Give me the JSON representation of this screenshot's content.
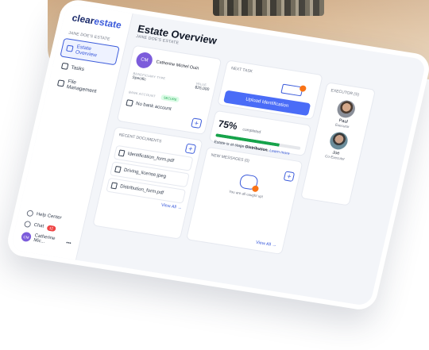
{
  "app": {
    "logo_text": "clear",
    "logo_accent": "estate",
    "brand_color": "#3b5bdb"
  },
  "sidebar": {
    "estate_label": "JANE DOE'S ESTATE",
    "items": [
      {
        "label": "Estate Overview",
        "icon": "home-icon",
        "active": true
      },
      {
        "label": "Tasks",
        "icon": "list-icon",
        "active": false
      },
      {
        "label": "File Management",
        "icon": "file-icon",
        "active": false
      }
    ],
    "help_label": "Help Center",
    "chat_label": "Chat",
    "chat_badge": "12",
    "user_initials": "CM",
    "user_name": "Catherine Mic...",
    "more": "•••"
  },
  "header": {
    "title": "Estate Overview",
    "subtitle": "JANE DOE'S ESTATE"
  },
  "beneficiary": {
    "initials": "CM",
    "name": "Catherine Michel Ouin",
    "type_label": "BENEFICIARY TYPE",
    "type_value": "Specific",
    "value_label": "VALUE",
    "value_value": "$25,000",
    "bank_label": "BANK ACCOUNT",
    "secure_label": "SECURE",
    "bank_value": "No bank account"
  },
  "next_task": {
    "label": "NEXT TASK",
    "button": "Upload Identification"
  },
  "progress": {
    "percent": "75%",
    "percent_value": 75,
    "completed_label": "completed",
    "stage_prefix": "Estate is at stage",
    "stage": "Distribution.",
    "learn_more": "Learn more"
  },
  "executors": {
    "label": "EXECUTOR (S)",
    "people": [
      {
        "name": "Paul",
        "role": "Executor"
      },
      {
        "name": "Joe",
        "role": "Co-Executor"
      }
    ]
  },
  "documents": {
    "label": "RECENT DOCUMENTS",
    "files": [
      "Identification_form.pdf",
      "Driving_license.jpeg",
      "Distribution_form.pdf"
    ],
    "view_all": "View All"
  },
  "messages": {
    "label": "NEW MESSAGES (0)",
    "empty_text": "You are all caught up!",
    "view_all": "View All"
  }
}
